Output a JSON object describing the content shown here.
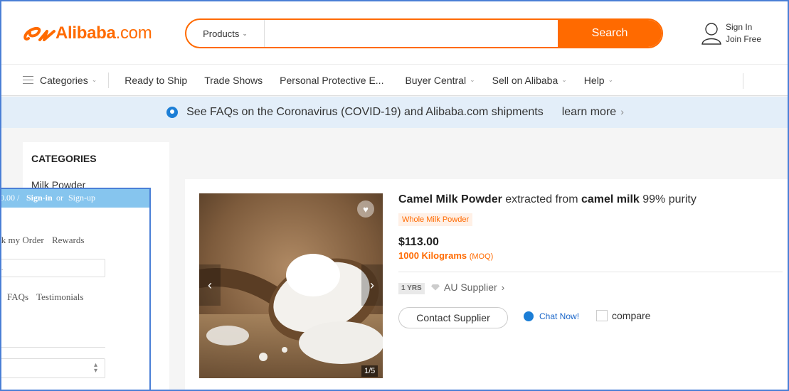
{
  "header": {
    "logo_brand": "Alibaba",
    "logo_suffix": ".com",
    "search": {
      "category": "Products",
      "placeholder": "",
      "button": "Search"
    },
    "account": {
      "sign_in": "Sign In",
      "join": "Join Free"
    }
  },
  "nav": {
    "categories": "Categories",
    "items": [
      "Ready to Ship",
      "Trade Shows",
      "Personal Protective E...",
      "Buyer Central",
      "Sell on Alibaba",
      "Help"
    ]
  },
  "banner": {
    "text": "See FAQs on the Coronavirus (COVID-19) and Alibaba.com shipments",
    "link": "learn more"
  },
  "sidebar": {
    "title": "CATEGORIES",
    "items": [
      "Milk Powder"
    ]
  },
  "product": {
    "title_part1": "Camel Milk Powder",
    "title_part2": " extracted from ",
    "title_part3": "camel milk",
    "title_part4": " 99% purity",
    "tag": "Whole Milk Powder",
    "price": "$113.00",
    "moq_value": "1000 Kilograms",
    "moq_label": "(MOQ)",
    "years": "1 YRS",
    "supplier": "AU Supplier",
    "contact_button": "Contact Supplier",
    "chat": "Chat Now!",
    "compare": "compare",
    "image_counter": "1/5"
  },
  "overlay": {
    "price": "0.00 /",
    "sign_in": "Sign-in",
    "or": "or",
    "sign_up": "Sign-up",
    "links_row1": [
      "ck my Order",
      "Rewards"
    ],
    "field_value": "..",
    "links_row2": [
      "FAQs",
      "Testimonials"
    ]
  },
  "colors": {
    "accent": "#ff6a00",
    "banner_bg": "#e3eef9",
    "overlay_bar": "#86c5ee",
    "frame_border": "#4a7fd6"
  }
}
